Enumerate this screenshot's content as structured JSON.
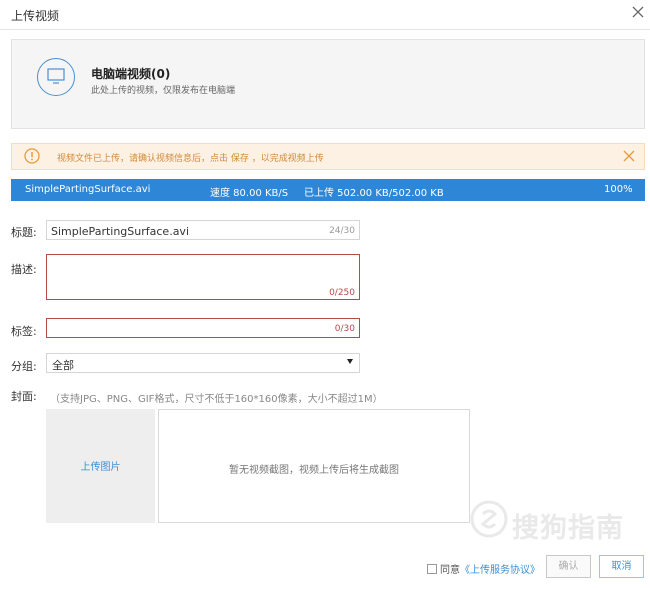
{
  "dialog": {
    "title": "上传视频"
  },
  "source": {
    "name": "电脑端视频(0)",
    "desc": "此处上传的视频，仅限发布在电脑端"
  },
  "notice": {
    "text": "视频文件已上传，请确认视频信息后，点击 保存 ，以完成视频上传"
  },
  "progress": {
    "filename": "SimplePartingSurface.avi",
    "speed": "速度 80.00 KB/S",
    "uploaded": "已上传 502.00 KB/502.00 KB",
    "percent_label": "100%",
    "fraction": 1.0
  },
  "form": {
    "title_label": "标题:",
    "title_value": "SimplePartingSurface.avi",
    "title_count": "24/30",
    "desc_label": "描述:",
    "desc_value": "",
    "desc_count": "0/250",
    "tags_label": "标签:",
    "tags_value": "",
    "tags_count": "0/30",
    "group_label": "分组:",
    "group_value": "全部",
    "cover_label": "封面:",
    "cover_hint": "（支持JPG、PNG、GIF格式，尺寸不低于160*160像素，大小不超过1M）",
    "upload_image": "上传图片",
    "no_screenshot": "暂无视频截图，视频上传后将生成截图"
  },
  "footer": {
    "agree_label": "同意",
    "agreement_link": "《上传服务协议》",
    "confirm_label": "确认",
    "cancel_label": "取消"
  },
  "watermark": {
    "text": "搜狗指南"
  },
  "colors": {
    "accent": "#2d86d6",
    "error": "#b94a48",
    "warning": "#d08a3b",
    "warning_bg": "#fdf1e4"
  }
}
